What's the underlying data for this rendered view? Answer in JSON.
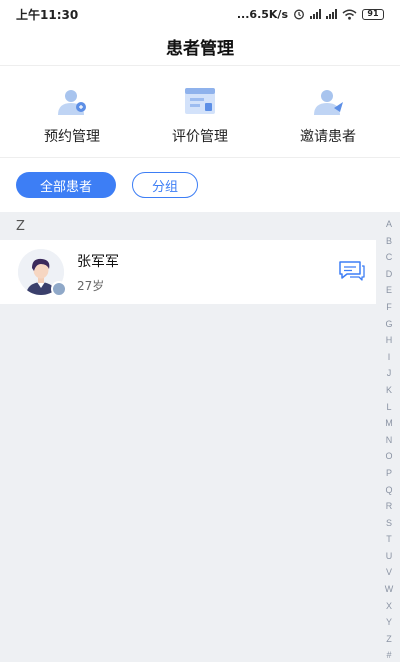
{
  "status_bar": {
    "time": "上午11:30",
    "network_speed": "...6.5K/s",
    "battery": "91",
    "icons": [
      "alarm-icon",
      "signal-icon",
      "signal-icon",
      "wifi-icon",
      "battery-icon"
    ]
  },
  "header": {
    "title": "患者管理"
  },
  "quick_menu": [
    {
      "label": "预约管理",
      "icon": "appointment-person-icon"
    },
    {
      "label": "评价管理",
      "icon": "review-board-icon"
    },
    {
      "label": "邀请患者",
      "icon": "invite-person-icon"
    }
  ],
  "filters": {
    "all_label": "全部患者",
    "group_label": "分组"
  },
  "sections": [
    {
      "letter": "Z",
      "patients": [
        {
          "name": "张军军",
          "age": "27岁"
        }
      ]
    }
  ],
  "alphabet": [
    "A",
    "B",
    "C",
    "D",
    "E",
    "F",
    "G",
    "H",
    "I",
    "J",
    "K",
    "L",
    "M",
    "N",
    "O",
    "P",
    "Q",
    "R",
    "S",
    "T",
    "U",
    "V",
    "W",
    "X",
    "Y",
    "Z",
    "#"
  ],
  "colors": {
    "accent": "#3d7ef5",
    "list_background": "#eef0f3",
    "index_text": "#8a93a3"
  }
}
